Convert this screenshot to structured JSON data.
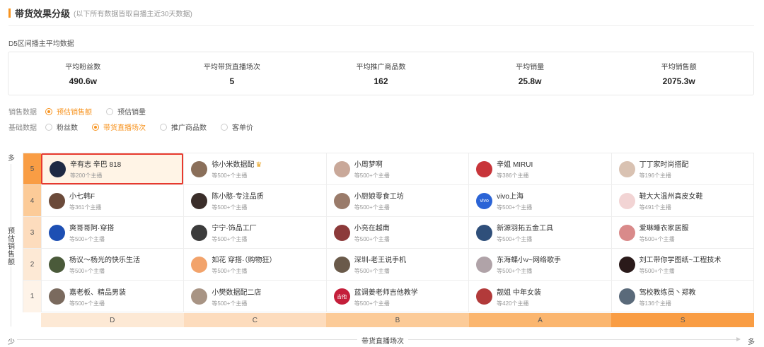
{
  "header": {
    "title": "带货效果分级",
    "subtitle": "(以下所有数据皆取自播主近30天数据)"
  },
  "section_label": "D5区间播主平均数据",
  "stats": [
    {
      "label": "平均粉丝数",
      "value": "490.6w"
    },
    {
      "label": "平均带货直播场次",
      "value": "5"
    },
    {
      "label": "平均推广商品数",
      "value": "162"
    },
    {
      "label": "平均销量",
      "value": "25.8w"
    },
    {
      "label": "平均销售额",
      "value": "2075.3w"
    }
  ],
  "filters": {
    "sales": {
      "title": "销售数据",
      "options": [
        {
          "label": "预估销售额",
          "active": true
        },
        {
          "label": "预估销量",
          "active": false
        }
      ]
    },
    "basic": {
      "title": "基础数据",
      "options": [
        {
          "label": "粉丝数",
          "active": false
        },
        {
          "label": "带货直播场次",
          "active": true
        },
        {
          "label": "推广商品数",
          "active": false
        },
        {
          "label": "客单价",
          "active": false
        }
      ]
    }
  },
  "axis": {
    "y_top": "多",
    "y_label": "预估销售额",
    "y_bottom": "少",
    "x_title": "带货直播场次",
    "x_more": "多"
  },
  "x_levels": [
    {
      "label": "D",
      "color": "#fde9d5"
    },
    {
      "label": "C",
      "color": "#fddcbd"
    },
    {
      "label": "B",
      "color": "#fccb98"
    },
    {
      "label": "A",
      "color": "#fbb66f"
    },
    {
      "label": "S",
      "color": "#f99d44"
    }
  ],
  "rows": [
    {
      "level": "5",
      "level_color": "#f99d44",
      "cells": [
        {
          "name": "辛有志 辛巴 818",
          "count": "等200个主播",
          "avatar_color": "#1f2a44",
          "highlight": true,
          "selected": true
        },
        {
          "name": "徐小米数据配",
          "count": "等500+个主播",
          "avatar_color": "#8a6f5a",
          "badge_icon": "crown-icon"
        },
        {
          "name": "小周梦啊",
          "count": "等500+个主播",
          "avatar_color": "#c9a899"
        },
        {
          "name": "辛姐 MIRUI",
          "count": "等386个主播",
          "avatar_color": "#c8353a"
        },
        {
          "name": "丁丁家时尚搭配",
          "count": "等196个主播",
          "avatar_color": "#d9c2b2"
        }
      ]
    },
    {
      "level": "4",
      "level_color": "#fccb98",
      "cells": [
        {
          "name": "小七韩F",
          "count": "等361个主播",
          "avatar_color": "#6b4a3a"
        },
        {
          "name": "陈小憨-专注品质",
          "count": "等500+个主播",
          "avatar_color": "#3a2e2a"
        },
        {
          "name": "小厨娘零食工坊",
          "count": "等500+个主播",
          "avatar_color": "#9a7b6a"
        },
        {
          "name": "vivo上海",
          "count": "等500+个主播",
          "avatar_color": "#2b64d6",
          "avatar_text": "vivo"
        },
        {
          "name": "鞋大大温州真皮女鞋",
          "count": "等491个主播",
          "avatar_color": "#f2d4d4"
        }
      ]
    },
    {
      "level": "3",
      "level_color": "#fddcbd",
      "cells": [
        {
          "name": "爽哥哥阿·穿搭",
          "count": "等500+个主播",
          "avatar_color": "#1d4fb3"
        },
        {
          "name": "宁宁·饰品工厂",
          "count": "等500+个主播",
          "avatar_color": "#3c3c3c"
        },
        {
          "name": "小亮在越南",
          "count": "等500+个主播",
          "avatar_color": "#8c3a3a"
        },
        {
          "name": "新源羽拓五金工具",
          "count": "等500+个主播",
          "avatar_color": "#2f4f7a"
        },
        {
          "name": "爱琳睡衣家居服",
          "count": "等500+个主播",
          "avatar_color": "#d98a8a"
        }
      ]
    },
    {
      "level": "2",
      "level_color": "#fde9d5",
      "cells": [
        {
          "name": "杨议～杨光的快乐生活",
          "count": "等500+个主播",
          "avatar_color": "#4a5a3a"
        },
        {
          "name": "如花 穿搭·（购物狂）",
          "count": "等500+个主播",
          "avatar_color": "#f2a36b"
        },
        {
          "name": "深圳-老王说手机",
          "count": "等500+个主播",
          "avatar_color": "#6a5a4a"
        },
        {
          "name": "东海蝶小v~网络歌手",
          "count": "等500+个主播",
          "avatar_color": "#b0a3a8"
        },
        {
          "name": "刘工带你学图纸~工程技术",
          "count": "等500+个主播",
          "avatar_color": "#2a1a1a"
        }
      ]
    },
    {
      "level": "1",
      "level_color": "#fef3e8",
      "cells": [
        {
          "name": "嘉老板、精品男装",
          "count": "等500+个主播",
          "avatar_color": "#7a6a5e"
        },
        {
          "name": "小樊数据配二店",
          "count": "等500+个主播",
          "avatar_color": "#a89484"
        },
        {
          "name": "蓝调姜老师吉他教学",
          "count": "等500+个主播",
          "avatar_color": "#c41e3a",
          "avatar_text": "吉他"
        },
        {
          "name": "靓姐 中年女装",
          "count": "等420个主播",
          "avatar_color": "#b23a3a"
        },
        {
          "name": "驾校教练员丶郑教",
          "count": "等136个主播",
          "avatar_color": "#5a6a7a"
        }
      ]
    }
  ]
}
